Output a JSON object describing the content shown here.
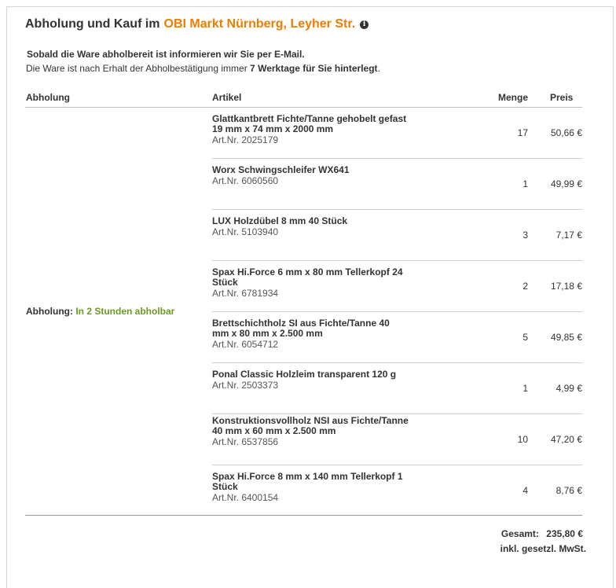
{
  "header": {
    "title_prefix": "Abholung und Kauf im",
    "market_name": "OBI Markt Nürnberg, Leyher Str.",
    "info_glyph": "i",
    "accent_color": "#ee7d00"
  },
  "notice": {
    "line1": "Sobald die Ware abholbereit ist informieren wir Sie per E-Mail.",
    "line2_prefix": "Die Ware ist nach Erhalt der Abholbestätigung immer",
    "line2_days": "7",
    "line2_bold_suffix": "Werktage für Sie hinterlegt",
    "line2_end": "."
  },
  "table": {
    "columns": {
      "abholung": "Abholung",
      "artikel": "Artikel",
      "menge": "Menge",
      "preis": "Preis"
    },
    "pickup_label": "Abholung:",
    "pickup_status": "In 2 Stunden abholbar",
    "pickup_color": "#6a9a1f",
    "items": [
      {
        "name": "Glattkantbrett Fichte/Tanne gehobelt gefast 19 mm x 74 mm x 2000 mm",
        "artnr": "Art.Nr. 2025179",
        "qty": "17",
        "price": "50,66 €"
      },
      {
        "name": "Worx Schwingschleifer WX641",
        "artnr": "Art.Nr. 6060560",
        "qty": "1",
        "price": "49,99 €"
      },
      {
        "name": "LUX Holzdübel 8 mm 40 Stück",
        "artnr": "Art.Nr. 5103940",
        "qty": "3",
        "price": "7,17 €"
      },
      {
        "name": "Spax Hi.Force 6 mm x 80 mm Tellerkopf 24 Stück",
        "artnr": "Art.Nr. 6781934",
        "qty": "2",
        "price": "17,18 €"
      },
      {
        "name": "Brettschichtholz SI aus Fichte/Tanne 40 mm x 80 mm x 2.500 mm",
        "artnr": "Art.Nr. 6054712",
        "qty": "5",
        "price": "49,85 €"
      },
      {
        "name": "Ponal Classic Holzleim transparent 120 g",
        "artnr": "Art.Nr. 2503373",
        "qty": "1",
        "price": "4,99 €"
      },
      {
        "name": "Konstruktionsvollholz NSI aus Fichte/Tanne 40 mm x 60 mm x 2.500 mm",
        "artnr": "Art.Nr. 6537856",
        "qty": "10",
        "price": "47,20 €"
      },
      {
        "name": "Spax Hi.Force 8 mm x 140 mm Tellerkopf 1 Stück",
        "artnr": "Art.Nr. 6400154",
        "qty": "4",
        "price": "8,76 €"
      }
    ]
  },
  "summary": {
    "total_label": "Gesamt:",
    "total_value": "235,80 €",
    "vat_note": "inkl. gesetzl. MwSt."
  }
}
